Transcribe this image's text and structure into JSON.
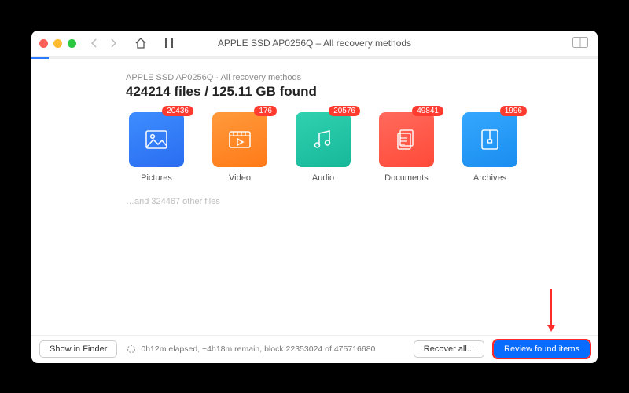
{
  "window": {
    "title": "APPLE SSD AP0256Q – All recovery methods"
  },
  "progress": {
    "percent": 3
  },
  "summary": {
    "breadcrumb": "APPLE SSD AP0256Q · All recovery methods",
    "found_line": "424214 files / 125.11 GB found",
    "other_files": "…and 324467 other files"
  },
  "tiles": [
    {
      "label": "Pictures",
      "badge": "20436",
      "color1": "#3d8dff",
      "color2": "#2a6df0",
      "icon": "picture"
    },
    {
      "label": "Video",
      "badge": "176",
      "color1": "#ff9a3c",
      "color2": "#ff7a18",
      "icon": "video"
    },
    {
      "label": "Audio",
      "badge": "20576",
      "color1": "#2fd1b0",
      "color2": "#17b89a",
      "icon": "audio"
    },
    {
      "label": "Documents",
      "badge": "49841",
      "color1": "#ff6a5c",
      "color2": "#ff4a39",
      "icon": "document"
    },
    {
      "label": "Archives",
      "badge": "1996",
      "color1": "#34a8ff",
      "color2": "#1a8def",
      "icon": "archive"
    }
  ],
  "footer": {
    "show_in_finder": "Show in Finder",
    "status": "0h12m elapsed, ~4h18m remain, block 22353024 of 475716680",
    "recover_all": "Recover all...",
    "review": "Review found items"
  }
}
